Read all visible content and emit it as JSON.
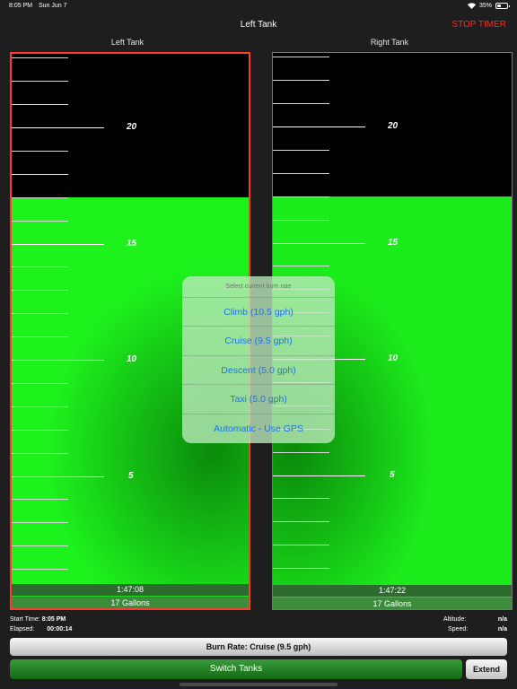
{
  "status_bar": {
    "time": "8:05 PM",
    "date": "Sun Jun 7",
    "battery": "35%",
    "battery_level": 0.35
  },
  "nav": {
    "title": "Left Tank",
    "stop_timer": "STOP TIMER"
  },
  "tanks": {
    "left": {
      "label": "Left Tank",
      "elapsed": "1:47:08",
      "gallons": "17 Gallons",
      "fill_gallons": 17
    },
    "right": {
      "label": "Right Tank",
      "elapsed": "1:47:22",
      "gallons": "17 Gallons",
      "fill_gallons": 17
    }
  },
  "gauge_scale": {
    "max_gallons": 24,
    "tick_step": 1,
    "major_labels": [
      "20",
      "15",
      "10",
      "5"
    ],
    "major_values": [
      20,
      15,
      10,
      5
    ]
  },
  "info": {
    "start_time_label": "Start Time:",
    "start_time": "8:05 PM",
    "elapsed_label": "Elapsed:",
    "elapsed": "00:00:14",
    "altitude_label": "Altitude:",
    "altitude": "n/a",
    "speed_label": "Speed:",
    "speed": "n/a"
  },
  "burn_rate_label": "Burn Rate: Cruise (9.5 gph)",
  "switch_tanks_label": "Switch Tanks",
  "extend_label": "Extend",
  "popup": {
    "header": "Select current burn rate",
    "options": [
      "Climb (10.5 gph)",
      "Cruise (9.5 gph)",
      "Descent (5.0 gph)",
      "Taxi (5.0 gph)",
      "Automatic - Use GPS"
    ]
  },
  "colors": {
    "accent_red": "#ff3b30",
    "fuel_green": "#1df21d",
    "link_blue": "#1e74e8"
  }
}
